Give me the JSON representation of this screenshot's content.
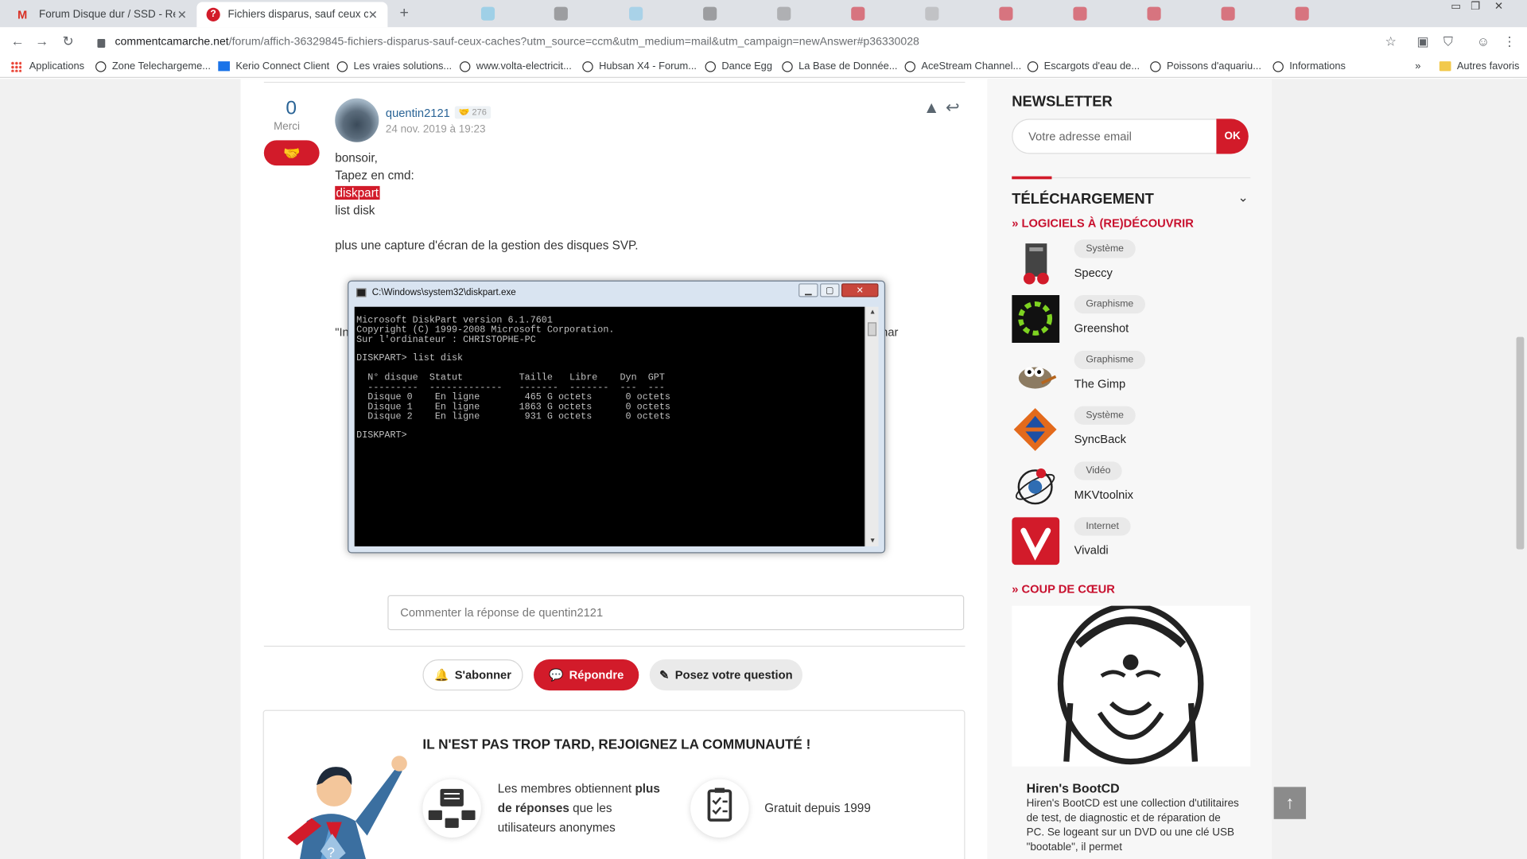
{
  "tabs": [
    {
      "title": "Forum Disque dur / SSD - Répon",
      "favicon": "gmail-icon"
    },
    {
      "title": "Fichiers disparus, sauf ceux cach",
      "favicon": "ccm-question-icon"
    }
  ],
  "address": {
    "host": "commentcamarche.net",
    "path": "/forum/affich-36329845-fichiers-disparus-sauf-ceux-caches?utm_source=ccm&utm_medium=mail&utm_campaign=newAnswer#p36330028"
  },
  "bookmarks": [
    {
      "label": "Applications",
      "icon": "apps-grid-icon"
    },
    {
      "label": "Zone Telechargeme...",
      "icon": "globe-icon"
    },
    {
      "label": "Kerio Connect Client",
      "icon": "mail-icon"
    },
    {
      "label": "Les vraies solutions...",
      "icon": "globe-icon"
    },
    {
      "label": "www.volta-electricit...",
      "icon": "globe-icon"
    },
    {
      "label": "Hubsan X4 - Forum...",
      "icon": "globe-icon"
    },
    {
      "label": "Dance Egg",
      "icon": "globe-icon"
    },
    {
      "label": "La Base de Donnée...",
      "icon": "globe-icon"
    },
    {
      "label": "AceStream Channel...",
      "icon": "globe-icon"
    },
    {
      "label": "Escargots d'eau de...",
      "icon": "globe-icon"
    },
    {
      "label": "Poissons d'aquariu...",
      "icon": "globe-icon"
    },
    {
      "label": "Informations",
      "icon": "globe-icon"
    }
  ],
  "bookmarks_more": "»",
  "other_bookmarks": "Autres favoris",
  "post": {
    "votes": "0",
    "votes_label": "Merci",
    "author": "quentin2121",
    "reputation": "276",
    "date": "24 nov. 2019 à 19:23",
    "lines": [
      "bonsoir,",
      "Tapez en cmd:",
      "diskpart",
      "list disk",
      "plus une capture d'écran de la gestion des disques SVP."
    ],
    "behind_left": "\"In",
    "behind_right": "har"
  },
  "console": {
    "title": "C:\\Windows\\system32\\diskpart.exe",
    "lines": [
      "Microsoft DiskPart version 6.1.7601",
      "Copyright (C) 1999-2008 Microsoft Corporation.",
      "Sur l'ordinateur : CHRISTOPHE-PC",
      "",
      "DISKPART> list disk",
      "",
      "  N° disque  Statut          Taille   Libre    Dyn  GPT",
      "  ---------  -------------   -------  -------  ---  ---",
      "  Disque 0    En ligne        465 G octets      0 octets",
      "  Disque 1    En ligne       1863 G octets      0 octets",
      "  Disque 2    En ligne        931 G octets      0 octets",
      "",
      "DISKPART>"
    ]
  },
  "comment_placeholder": "Commenter la réponse de quentin2121",
  "actions": {
    "subscribe": "S'abonner",
    "respond": "Répondre",
    "ask": "Posez votre question"
  },
  "join": {
    "title": "IL N'EST PAS TROP TARD, REJOIGNEZ LA COMMUNAUTÉ !",
    "feature1_a": "Les membres obtiennent ",
    "feature1_b": "plus de réponses",
    "feature1_c": " que les utilisateurs anonymes",
    "feature2": "Gratuit depuis 1999"
  },
  "sidebar": {
    "newsletter_title": "NEWSLETTER",
    "email_placeholder": "Votre adresse email",
    "ok": "OK",
    "download_title": "TÉLÉCHARGEMENT",
    "section_software": "LOGICIELS À (RE)DÉCOUVRIR",
    "software": [
      {
        "category": "Système",
        "name": "Speccy",
        "icon": "speccy-icon"
      },
      {
        "category": "Graphisme",
        "name": "Greenshot",
        "icon": "greenshot-icon"
      },
      {
        "category": "Graphisme",
        "name": "The Gimp",
        "icon": "gimp-icon"
      },
      {
        "category": "Système",
        "name": "SyncBack",
        "icon": "syncback-icon"
      },
      {
        "category": "Vidéo",
        "name": "MKVtoolnix",
        "icon": "mkvtoolnix-icon"
      },
      {
        "category": "Internet",
        "name": "Vivaldi",
        "icon": "vivaldi-icon"
      }
    ],
    "section_favorite": "COUP DE CŒUR",
    "favorite_title": "Hiren's BootCD",
    "favorite_desc": "Hiren's BootCD est une collection d'utilitaires de test, de diagnostic et de réparation de PC. Se logeant sur un DVD ou une clé USB \"bootable\", il permet"
  },
  "colors": {
    "accent": "#d21b2a",
    "link": "#2a6496"
  }
}
